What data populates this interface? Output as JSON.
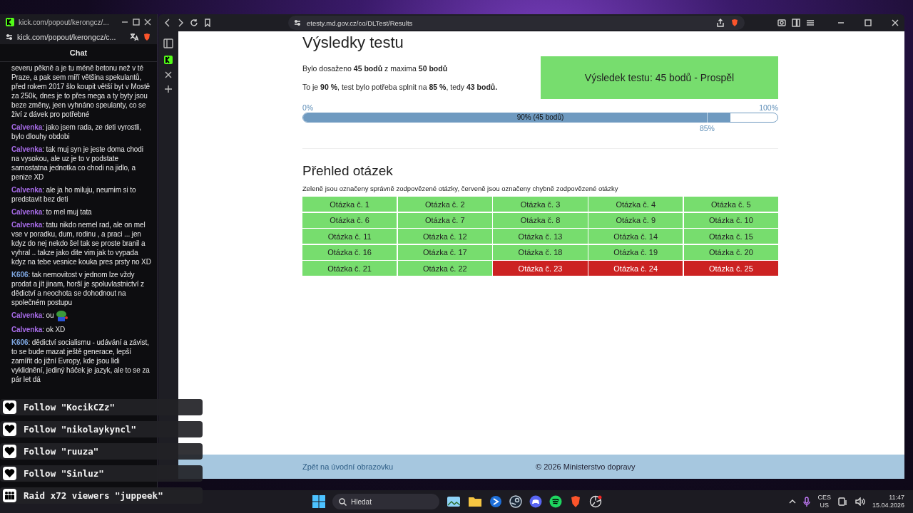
{
  "chat_window": {
    "title": "kick.com/popout/kerongcz/...",
    "address": "kick.com/popout/kerongcz/c...",
    "header": "Chat",
    "messages": [
      {
        "text": "severu pěkně a je tu méně betonu než v té Praze, a pak sem míří většina spekulantů, před rokem 2017 šlo koupit větší byt v Mostě za 250k, dnes je to přes mega a ty byty jsou beze změny, jeen vyhnáno speulanty, co se živí z dávek pro potřebné",
        "emote": false
      },
      {
        "user": "Calvenka",
        "color": "#a66be6",
        "text": ": jako jsem rada, ze deti vyrostli, bylo dlouhy obdobi",
        "emote": false
      },
      {
        "user": "Calvenka",
        "color": "#a66be6",
        "text": ": tak muj syn je jeste doma chodi na vysokou, ale uz je to v podstate samostatna jednotka co chodi na jidlo, a penize XD",
        "emote": false
      },
      {
        "user": "Calvenka",
        "color": "#a66be6",
        "text": ": ale ja ho miluju, neumim si to predstavit bez deti",
        "emote": false
      },
      {
        "user": "Calvenka",
        "color": "#a66be6",
        "text": ": to mel muj tata",
        "emote": false
      },
      {
        "user": "Calvenka",
        "color": "#a66be6",
        "text": ": tatu nikdo nemel rad, ale on mel vse v poradku, dum, rodinu , a praci ... jen kdyz do nej nekdo šel tak se proste branil a vyhral .. takze jako dite vim jak to vypada kdyz na tebe vesnice kouka pres prsty no XD",
        "emote": false
      },
      {
        "user": "K606",
        "color": "#7ea6e0",
        "text": ": tak nemovitost v jednom lze vždy prodat a jít jinam, horší je spoluvlastnictví z dědictví a neochota se dohodnout na společném postupu",
        "emote": false
      },
      {
        "user": "Calvenka",
        "color": "#a66be6",
        "text": ": ou",
        "emote": true
      },
      {
        "user": "Calvenka",
        "color": "#a66be6",
        "text": ": ok XD",
        "emote": false
      },
      {
        "user": "K606",
        "color": "#7ea6e0",
        "text": ": dědictví socialismu - udávání a závist, to se bude mazat ještě generace, lepší zamířit do jižní Evropy, kde jsou lidi vyklidnění, jediný háček je jazyk, ale to se za pár let dá",
        "emote": false
      }
    ]
  },
  "alerts": [
    {
      "kind": "follow",
      "text": "Follow \"KocikCZz\""
    },
    {
      "kind": "follow",
      "text": "Follow \"nikolaykyncl\""
    },
    {
      "kind": "follow",
      "text": "Follow \"ruuza\""
    },
    {
      "kind": "follow",
      "text": "Follow \"Sinluz\""
    },
    {
      "kind": "raid",
      "text": "Raid x72 viewers \"juppeek\""
    }
  ],
  "browser": {
    "url": "etesty.md.gov.cz/co/DLTest/Results"
  },
  "results": {
    "title": "Výsledky testu",
    "lines": [
      "Bylo dosaženo **45 bodů** z maxima **50 bodů**",
      "To je **90 %**, test bylo potřeba splnit na **85 %**, tedy **43 bodů.**"
    ],
    "verdict": {
      "text": "Výsledek testu: 45 bodů - Prospěl",
      "passed": true
    },
    "progress": {
      "min_label": "0%",
      "max_label": "100%",
      "level": 0.9,
      "label": "90% (45 bodů)",
      "threshold": {
        "level": 0.85,
        "label": "85%"
      }
    }
  },
  "overview": {
    "title": "Přehled otázek",
    "note": "Zeleně jsou označeny správně zodpovězené otázky, červeně jsou označeny chybně zodpovězené otázky",
    "questions": [
      {
        "label": "Otázka č. 1",
        "correct": true
      },
      {
        "label": "Otázka č. 2",
        "correct": true
      },
      {
        "label": "Otázka č. 3",
        "correct": true
      },
      {
        "label": "Otázka č. 4",
        "correct": true
      },
      {
        "label": "Otázka č. 5",
        "correct": true
      },
      {
        "label": "Otázka č. 6",
        "correct": true
      },
      {
        "label": "Otázka č. 7",
        "correct": true
      },
      {
        "label": "Otázka č. 8",
        "correct": true
      },
      {
        "label": "Otázka č. 9",
        "correct": true
      },
      {
        "label": "Otázka č. 10",
        "correct": true
      },
      {
        "label": "Otázka č. 11",
        "correct": true
      },
      {
        "label": "Otázka č. 12",
        "correct": true
      },
      {
        "label": "Otázka č. 13",
        "correct": true
      },
      {
        "label": "Otázka č. 14",
        "correct": true
      },
      {
        "label": "Otázka č. 15",
        "correct": true
      },
      {
        "label": "Otázka č. 16",
        "correct": true
      },
      {
        "label": "Otázka č. 17",
        "correct": true
      },
      {
        "label": "Otázka č. 18",
        "correct": true
      },
      {
        "label": "Otázka č. 19",
        "correct": true
      },
      {
        "label": "Otázka č. 20",
        "correct": true
      },
      {
        "label": "Otázka č. 21",
        "correct": true
      },
      {
        "label": "Otázka č. 22",
        "correct": true
      },
      {
        "label": "Otázka č. 23",
        "correct": false
      },
      {
        "label": "Otázka č. 24",
        "correct": false
      },
      {
        "label": "Otázka č. 25",
        "correct": false
      }
    ]
  },
  "footer": {
    "link": "Zpět na úvodní obrazovku",
    "copyright": "© 2026 Ministerstvo dopravy"
  },
  "taskbar": {
    "search_placeholder": "Hledat",
    "language": "CES",
    "layout": "US",
    "time": "11:47",
    "date": "15.04.2026"
  }
}
